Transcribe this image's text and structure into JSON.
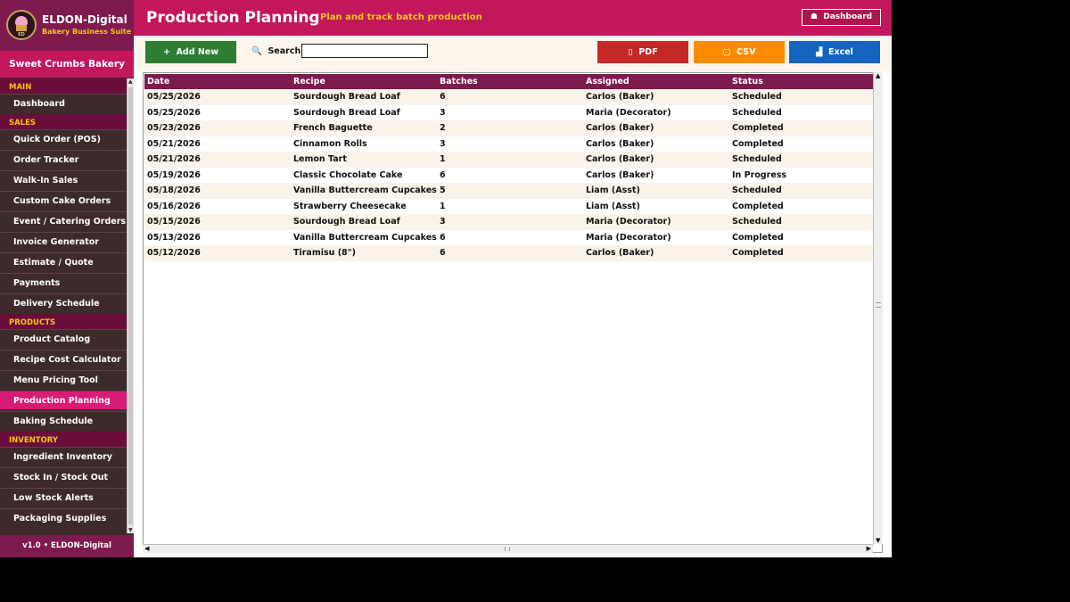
{
  "brand": {
    "name": "ELDON-Digital",
    "subtitle": "Bakery Business Suite",
    "logo_text": "ED"
  },
  "business_name": "Sweet Crumbs Bakery",
  "nav": [
    {
      "section": "MAIN",
      "items": [
        "Dashboard"
      ]
    },
    {
      "section": "SALES",
      "items": [
        "Quick Order (POS)",
        "Order Tracker",
        "Walk-In Sales",
        "Custom Cake Orders",
        "Event / Catering Orders",
        "Invoice Generator",
        "Estimate / Quote",
        "Payments",
        "Delivery Schedule"
      ]
    },
    {
      "section": "PRODUCTS",
      "items": [
        "Product Catalog",
        "Recipe Cost Calculator",
        "Menu Pricing Tool",
        "Production Planning",
        "Baking Schedule"
      ]
    },
    {
      "section": "INVENTORY",
      "items": [
        "Ingredient Inventory",
        "Stock In / Stock Out",
        "Low Stock Alerts",
        "Packaging Supplies"
      ]
    }
  ],
  "active_nav": "Production Planning",
  "version": "v1.0  •  ELDON-Digital",
  "header": {
    "title": "Production Planning",
    "subtitle": "Plan and track batch production",
    "dashboard_label": "Dashboard",
    "dashboard_icon": "home-icon"
  },
  "toolbar": {
    "add_label": "Add New",
    "search_label": "Search:",
    "search_value": "",
    "pdf_label": "PDF",
    "csv_label": "CSV",
    "excel_label": "Excel"
  },
  "table": {
    "columns": [
      "Date",
      "Recipe",
      "Batches",
      "Assigned",
      "Status"
    ],
    "rows": [
      [
        "05/25/2026",
        "Sourdough Bread Loaf",
        "6",
        "Carlos (Baker)",
        "Scheduled"
      ],
      [
        "05/25/2026",
        "Sourdough Bread Loaf",
        "3",
        "Maria (Decorator)",
        "Scheduled"
      ],
      [
        "05/23/2026",
        "French Baguette",
        "2",
        "Carlos (Baker)",
        "Completed"
      ],
      [
        "05/21/2026",
        "Cinnamon Rolls",
        "3",
        "Carlos (Baker)",
        "Completed"
      ],
      [
        "05/21/2026",
        "Lemon Tart",
        "1",
        "Carlos (Baker)",
        "Scheduled"
      ],
      [
        "05/19/2026",
        "Classic Chocolate Cake",
        "6",
        "Carlos (Baker)",
        "In Progress"
      ],
      [
        "05/18/2026",
        "Vanilla Buttercream Cupcakes",
        "5",
        "Liam (Asst)",
        "Scheduled"
      ],
      [
        "05/16/2026",
        "Strawberry Cheesecake",
        "1",
        "Liam (Asst)",
        "Completed"
      ],
      [
        "05/15/2026",
        "Sourdough Bread Loaf",
        "3",
        "Maria (Decorator)",
        "Scheduled"
      ],
      [
        "05/13/2026",
        "Vanilla Buttercream Cupcakes",
        "6",
        "Maria (Decorator)",
        "Completed"
      ],
      [
        "05/12/2026",
        "Tiramisu (8\")",
        "6",
        "Carlos (Baker)",
        "Completed"
      ]
    ]
  },
  "colors": {
    "header": "#c2185b",
    "sidebar": "#3d2a2a",
    "table_header": "#7e1a4e",
    "add": "#2e7d32",
    "pdf": "#c62828",
    "csv": "#fb8c00",
    "excel": "#1565c0"
  }
}
